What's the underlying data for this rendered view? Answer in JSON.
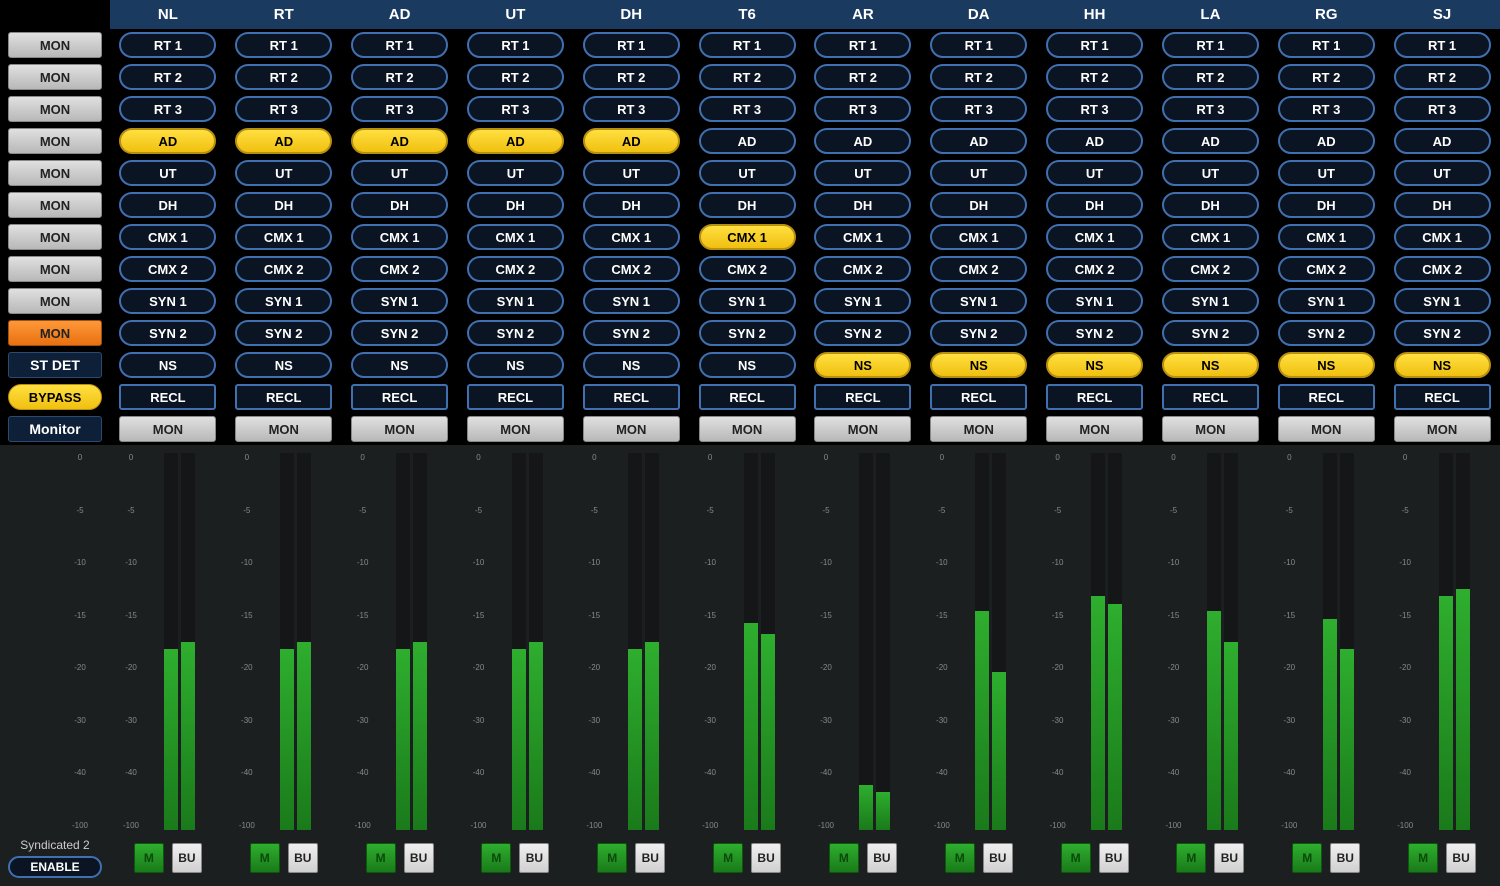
{
  "columns": [
    "NL",
    "RT",
    "AD",
    "UT",
    "DH",
    "T6",
    "AR",
    "DA",
    "HH",
    "LA",
    "RG",
    "SJ"
  ],
  "rows": [
    {
      "label": "MON",
      "labelStyle": "grey",
      "type": "pill",
      "cells": [
        {
          "text": "RT 1"
        },
        {
          "text": "RT 1"
        },
        {
          "text": "RT 1"
        },
        {
          "text": "RT 1"
        },
        {
          "text": "RT 1"
        },
        {
          "text": "RT 1"
        },
        {
          "text": "RT 1"
        },
        {
          "text": "RT 1"
        },
        {
          "text": "RT 1"
        },
        {
          "text": "RT 1"
        },
        {
          "text": "RT 1"
        },
        {
          "text": "RT 1"
        }
      ]
    },
    {
      "label": "MON",
      "labelStyle": "grey",
      "type": "pill",
      "cells": [
        {
          "text": "RT 2"
        },
        {
          "text": "RT 2"
        },
        {
          "text": "RT 2"
        },
        {
          "text": "RT 2"
        },
        {
          "text": "RT 2"
        },
        {
          "text": "RT 2"
        },
        {
          "text": "RT 2"
        },
        {
          "text": "RT 2"
        },
        {
          "text": "RT 2"
        },
        {
          "text": "RT 2"
        },
        {
          "text": "RT 2"
        },
        {
          "text": "RT 2"
        }
      ]
    },
    {
      "label": "MON",
      "labelStyle": "grey",
      "type": "pill",
      "cells": [
        {
          "text": "RT 3"
        },
        {
          "text": "RT 3"
        },
        {
          "text": "RT 3"
        },
        {
          "text": "RT 3"
        },
        {
          "text": "RT 3"
        },
        {
          "text": "RT 3"
        },
        {
          "text": "RT 3"
        },
        {
          "text": "RT 3"
        },
        {
          "text": "RT 3"
        },
        {
          "text": "RT 3"
        },
        {
          "text": "RT 3"
        },
        {
          "text": "RT 3"
        }
      ]
    },
    {
      "label": "MON",
      "labelStyle": "grey",
      "type": "pill",
      "cells": [
        {
          "text": "AD",
          "active": true
        },
        {
          "text": "AD",
          "active": true
        },
        {
          "text": "AD",
          "active": true
        },
        {
          "text": "AD",
          "active": true
        },
        {
          "text": "AD",
          "active": true
        },
        {
          "text": "AD"
        },
        {
          "text": "AD"
        },
        {
          "text": "AD"
        },
        {
          "text": "AD"
        },
        {
          "text": "AD"
        },
        {
          "text": "AD"
        },
        {
          "text": "AD"
        }
      ]
    },
    {
      "label": "MON",
      "labelStyle": "grey",
      "type": "pill",
      "cells": [
        {
          "text": "UT"
        },
        {
          "text": "UT"
        },
        {
          "text": "UT"
        },
        {
          "text": "UT"
        },
        {
          "text": "UT"
        },
        {
          "text": "UT"
        },
        {
          "text": "UT"
        },
        {
          "text": "UT"
        },
        {
          "text": "UT"
        },
        {
          "text": "UT"
        },
        {
          "text": "UT"
        },
        {
          "text": "UT"
        }
      ]
    },
    {
      "label": "MON",
      "labelStyle": "grey",
      "type": "pill",
      "cells": [
        {
          "text": "DH"
        },
        {
          "text": "DH"
        },
        {
          "text": "DH"
        },
        {
          "text": "DH"
        },
        {
          "text": "DH"
        },
        {
          "text": "DH"
        },
        {
          "text": "DH"
        },
        {
          "text": "DH"
        },
        {
          "text": "DH"
        },
        {
          "text": "DH"
        },
        {
          "text": "DH"
        },
        {
          "text": "DH"
        }
      ]
    },
    {
      "label": "MON",
      "labelStyle": "grey",
      "type": "pill",
      "cells": [
        {
          "text": "CMX 1"
        },
        {
          "text": "CMX 1"
        },
        {
          "text": "CMX 1"
        },
        {
          "text": "CMX 1"
        },
        {
          "text": "CMX 1"
        },
        {
          "text": "CMX 1",
          "active": true
        },
        {
          "text": "CMX 1"
        },
        {
          "text": "CMX 1"
        },
        {
          "text": "CMX 1"
        },
        {
          "text": "CMX 1"
        },
        {
          "text": "CMX 1"
        },
        {
          "text": "CMX 1"
        }
      ]
    },
    {
      "label": "MON",
      "labelStyle": "grey",
      "type": "pill",
      "cells": [
        {
          "text": "CMX 2"
        },
        {
          "text": "CMX 2"
        },
        {
          "text": "CMX 2"
        },
        {
          "text": "CMX 2"
        },
        {
          "text": "CMX 2"
        },
        {
          "text": "CMX 2"
        },
        {
          "text": "CMX 2"
        },
        {
          "text": "CMX 2"
        },
        {
          "text": "CMX 2"
        },
        {
          "text": "CMX 2"
        },
        {
          "text": "CMX 2"
        },
        {
          "text": "CMX 2"
        }
      ]
    },
    {
      "label": "MON",
      "labelStyle": "grey",
      "type": "pill",
      "cells": [
        {
          "text": "SYN 1"
        },
        {
          "text": "SYN 1"
        },
        {
          "text": "SYN 1"
        },
        {
          "text": "SYN 1"
        },
        {
          "text": "SYN 1"
        },
        {
          "text": "SYN 1"
        },
        {
          "text": "SYN 1"
        },
        {
          "text": "SYN 1"
        },
        {
          "text": "SYN 1"
        },
        {
          "text": "SYN 1"
        },
        {
          "text": "SYN 1"
        },
        {
          "text": "SYN 1"
        }
      ]
    },
    {
      "label": "MON",
      "labelStyle": "orange",
      "type": "pill",
      "cells": [
        {
          "text": "SYN 2"
        },
        {
          "text": "SYN 2"
        },
        {
          "text": "SYN 2"
        },
        {
          "text": "SYN 2"
        },
        {
          "text": "SYN 2"
        },
        {
          "text": "SYN 2"
        },
        {
          "text": "SYN 2"
        },
        {
          "text": "SYN 2"
        },
        {
          "text": "SYN 2"
        },
        {
          "text": "SYN 2"
        },
        {
          "text": "SYN 2"
        },
        {
          "text": "SYN 2"
        }
      ]
    },
    {
      "label": "ST DET",
      "labelStyle": "dark",
      "type": "pill",
      "cells": [
        {
          "text": "NS"
        },
        {
          "text": "NS"
        },
        {
          "text": "NS"
        },
        {
          "text": "NS"
        },
        {
          "text": "NS"
        },
        {
          "text": "NS"
        },
        {
          "text": "NS",
          "active": true
        },
        {
          "text": "NS",
          "active": true
        },
        {
          "text": "NS",
          "active": true
        },
        {
          "text": "NS",
          "active": true
        },
        {
          "text": "NS",
          "active": true
        },
        {
          "text": "NS",
          "active": true
        }
      ]
    },
    {
      "label": "BYPASS",
      "labelStyle": "yellow",
      "type": "rect",
      "cells": [
        {
          "text": "RECL"
        },
        {
          "text": "RECL"
        },
        {
          "text": "RECL"
        },
        {
          "text": "RECL"
        },
        {
          "text": "RECL"
        },
        {
          "text": "RECL"
        },
        {
          "text": "RECL"
        },
        {
          "text": "RECL"
        },
        {
          "text": "RECL"
        },
        {
          "text": "RECL"
        },
        {
          "text": "RECL"
        },
        {
          "text": "RECL"
        }
      ]
    },
    {
      "label": "Monitor",
      "labelStyle": "monitor",
      "type": "rectgrey",
      "cells": [
        {
          "text": "MON"
        },
        {
          "text": "MON"
        },
        {
          "text": "MON"
        },
        {
          "text": "MON"
        },
        {
          "text": "MON"
        },
        {
          "text": "MON"
        },
        {
          "text": "MON"
        },
        {
          "text": "MON"
        },
        {
          "text": "MON"
        },
        {
          "text": "MON"
        },
        {
          "text": "MON"
        },
        {
          "text": "MON"
        }
      ]
    }
  ],
  "scale": [
    "0",
    "-5",
    "-10",
    "-15",
    "-20",
    "-30",
    "-40",
    "-100"
  ],
  "meters": [
    {
      "l": 48,
      "r": 50
    },
    {
      "l": 48,
      "r": 50
    },
    {
      "l": 48,
      "r": 50
    },
    {
      "l": 48,
      "r": 50
    },
    {
      "l": 48,
      "r": 50
    },
    {
      "l": 55,
      "r": 52
    },
    {
      "l": 12,
      "r": 10
    },
    {
      "l": 58,
      "r": 42
    },
    {
      "l": 62,
      "r": 60
    },
    {
      "l": 58,
      "r": 50
    },
    {
      "l": 56,
      "r": 48
    },
    {
      "l": 62,
      "r": 64
    }
  ],
  "bottom": {
    "syndicated": "Syndicated 2",
    "enable": "ENABLE",
    "m": "M",
    "bu": "BU"
  }
}
